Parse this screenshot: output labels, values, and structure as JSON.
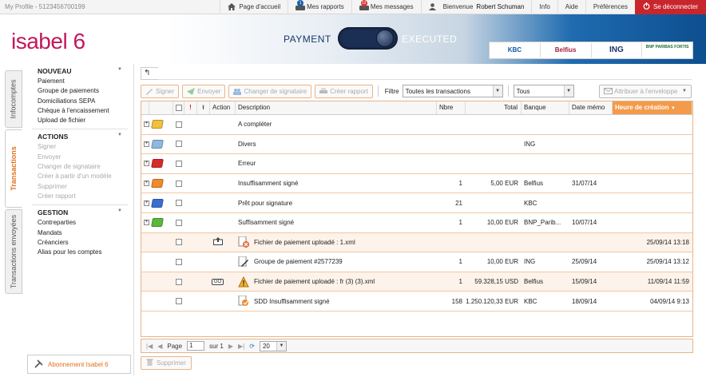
{
  "topbar": {
    "profile": "My Profile - 5123456700199",
    "home": "Page d'accueil",
    "reports": "Mes rapports",
    "reports_badge": "1",
    "messages": "Mes messages",
    "messages_badge": "12",
    "welcome": "Bienvenue",
    "user": "Robert Schuman",
    "info": "Info",
    "help": "Aide",
    "prefs": "Préférences",
    "logout": "Se déconnecter"
  },
  "banner": {
    "logo": "isabel 6",
    "payment": "PAYMENT",
    "executed": "EXECUTED",
    "banks": [
      "KBC",
      "Belfius",
      "ING",
      "BNP PARIBAS FORTIS"
    ]
  },
  "vtabs": [
    "Infocomptes",
    "Transactions",
    "Transactions envoyées"
  ],
  "sidebar": {
    "sections": [
      {
        "title": "NOUVEAU",
        "items": [
          {
            "label": "Paiement",
            "disabled": false
          },
          {
            "label": "Groupe de paiements",
            "disabled": false
          },
          {
            "label": "Domiciliations SEPA",
            "disabled": false
          },
          {
            "label": "Chèque à l'encaissement",
            "disabled": false
          },
          {
            "label": "Upload de fichier",
            "disabled": false
          }
        ]
      },
      {
        "title": "ACTIONS",
        "items": [
          {
            "label": "Signer",
            "disabled": true
          },
          {
            "label": "Envoyer",
            "disabled": true
          },
          {
            "label": "Changer de signataire",
            "disabled": true
          },
          {
            "label": "Créer à partir d'un modèle",
            "disabled": true
          },
          {
            "label": "Supprimer",
            "disabled": true
          },
          {
            "label": "Créer rapport",
            "disabled": true
          }
        ]
      },
      {
        "title": "GESTION",
        "items": [
          {
            "label": "Contreparties",
            "disabled": false
          },
          {
            "label": "Mandats",
            "disabled": false
          },
          {
            "label": "Créanciers",
            "disabled": false
          },
          {
            "label": "Alias pour les comptes",
            "disabled": false
          }
        ]
      }
    ],
    "abonnement": "Abonnement Isabel 6"
  },
  "toolbar": {
    "sign": "Signer",
    "send": "Envoyer",
    "change_signer": "Changer de signataire",
    "create_report": "Créer rapport",
    "filter_label": "Filtre",
    "filter_value": "Toutes les transactions",
    "filter2_value": "Tous",
    "envelope": "Attribuer à l'enveloppe"
  },
  "grid": {
    "headers": {
      "excl": "!",
      "action": "Action",
      "description": "Description",
      "nbre": "Nbre",
      "total": "Total",
      "banque": "Banque",
      "date_memo": "Date mémo",
      "heure": "Heure de création"
    },
    "folders": [
      {
        "color": "#f0c23a",
        "description": "A compléter",
        "nbre": "",
        "total": "",
        "banque": "",
        "date": ""
      },
      {
        "color": "#8fb8e0",
        "description": "Divers",
        "nbre": "",
        "total": "",
        "banque": "ING",
        "date": ""
      },
      {
        "color": "#d92a2a",
        "description": "Erreur",
        "nbre": "",
        "total": "",
        "banque": "",
        "date": ""
      },
      {
        "color": "#f08a2a",
        "description": "Insuffisamment signé",
        "nbre": "1",
        "total": "5,00 EUR",
        "banque": "Belfius",
        "date": "31/07/14"
      },
      {
        "color": "#3a6fd0",
        "description": "Prêt pour signature",
        "nbre": "21",
        "total": "",
        "banque": "KBC",
        "date": ""
      },
      {
        "color": "#5ab83a",
        "description": "Suffisamment signé",
        "nbre": "1",
        "total": "10,00 EUR",
        "banque": "BNP_Parib...",
        "date": "10/07/14"
      }
    ],
    "items": [
      {
        "action": "upload",
        "status": "error",
        "description": "Fichier de paiement uploadé : 1.xml",
        "nbre": "",
        "total": "",
        "banque": "",
        "date": "",
        "heure": "25/09/14 13:18"
      },
      {
        "action": "",
        "status": "sign",
        "description": "Groupe de paiement #2577239",
        "nbre": "1",
        "total": "10,00 EUR",
        "banque": "ING",
        "date": "25/09/14",
        "heure": "25/09/14 13:12"
      },
      {
        "action": "GO",
        "status": "warning",
        "description": "Fichier de paiement uploadé : fr (3) (3).xml",
        "nbre": "1",
        "total": "59.328,15 USD",
        "banque": "Belfius",
        "date": "15/09/14",
        "heure": "11/09/14 11:59"
      },
      {
        "action": "",
        "status": "partial",
        "description": "SDD Insuffisamment signé",
        "nbre": "158",
        "total": "1.250.120,33 EUR",
        "banque": "KBC",
        "date": "18/09/14",
        "heure": "04/09/14 9:13"
      }
    ]
  },
  "pager": {
    "page_label": "Page",
    "page_value": "1",
    "of_label": "sur 1",
    "page_size": "20"
  },
  "delete_button": "Supprimer"
}
